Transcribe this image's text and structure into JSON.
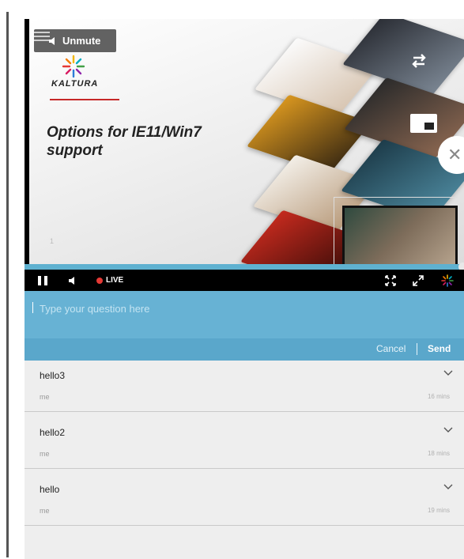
{
  "player": {
    "unmute_label": "Unmute",
    "live_label": "LIVE",
    "slide": {
      "logo_text": "KALTURA",
      "title": "Options for IE11/Win7 support",
      "slide_number": "1"
    }
  },
  "question": {
    "placeholder": "Type your question here",
    "cancel_label": "Cancel",
    "send_label": "Send"
  },
  "questions": [
    {
      "text": "hello3",
      "author": "me",
      "time": "16 mins"
    },
    {
      "text": "hello2",
      "author": "me",
      "time": "18 mins"
    },
    {
      "text": "hello",
      "author": "me",
      "time": "19 mins"
    }
  ],
  "colors": {
    "accent": "#67b2d4",
    "live_dot": "#e53935",
    "list_bg": "#eeeeee",
    "logo_line": "#c62828"
  }
}
